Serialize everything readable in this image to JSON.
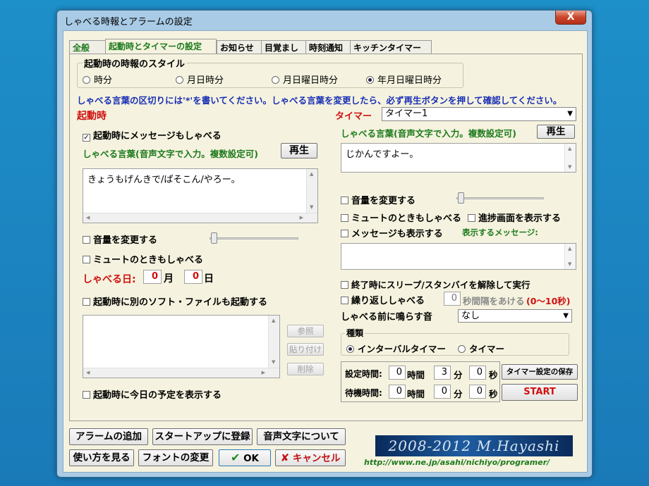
{
  "window": {
    "title": "しゃべる時報とアラームの設定",
    "close_label": "X"
  },
  "tabs": [
    {
      "label": "全般"
    },
    {
      "label": "起動時とタイマーの設定"
    },
    {
      "label": "お知らせ"
    },
    {
      "label": "目覚まし"
    },
    {
      "label": "時刻通知"
    },
    {
      "label": "キッチンタイマー"
    }
  ],
  "style_group": {
    "title": "起動時の時報のスタイル",
    "options": [
      "時分",
      "月日時分",
      "月日曜日時分",
      "年月日曜日時分"
    ],
    "selected": "年月日曜日時分"
  },
  "note": "しゃべる言葉の区切りには'*'を書いてください。しゃべる言葉を変更したら、必ず再生ボタンを押して確認してください。",
  "startup": {
    "heading": "起動時",
    "speak_message_check": "起動時にメッセージもしゃべる",
    "speak_words_label": "しゃべる言葉(音声文字で入力。複数設定可)",
    "play_label": "再生",
    "message_text": "きょうもげんきで/ぱそこん/やろー。",
    "change_volume": "音量を変更する",
    "speak_when_muted": "ミュートのときもしゃべる",
    "speak_day_label": "しゃべる日:",
    "month_value": "0",
    "month_unit": "月",
    "day_value": "0",
    "day_unit": "日",
    "launch_other": "起動時に別のソフト・ファイルも起動する",
    "browse_label": "参照",
    "paste_label": "貼り付け",
    "delete_label": "削除",
    "show_schedule": "起動時に今日の予定を表示する"
  },
  "timer": {
    "heading": "タイマー",
    "selected_timer": "タイマー1",
    "speak_words_label": "しゃべる言葉(音声文字で入力。複数設定可)",
    "play_label": "再生",
    "message_text": "じかんですよー。",
    "change_volume": "音量を変更する",
    "speak_when_muted": "ミュートのときもしゃべる",
    "show_progress": "進捗画面を表示する",
    "show_message": "メッセージも表示する",
    "display_message_label": "表示するメッセージ:",
    "release_sleep": "終了時にスリープ/スタンバイを解除して実行",
    "repeat_label": "繰り返ししゃべる",
    "repeat_value": "0",
    "interval_label": "秒間隔をあける",
    "interval_range": "(0〜10秒)",
    "sound_before_label": "しゃべる前に鳴らす音",
    "sound_before_value": "なし",
    "type_group_title": "種類",
    "type_options": [
      "インターバルタイマー",
      "タイマー"
    ],
    "type_selected": "インターバルタイマー",
    "set_time_label": "設定時間:",
    "wait_time_label": "待機時間:",
    "set_hours": "0",
    "set_minutes": "3",
    "set_seconds": "0",
    "wait_hours": "0",
    "wait_minutes": "0",
    "wait_seconds": "0",
    "unit_hours": "時間",
    "unit_minutes": "分",
    "unit_seconds": "秒",
    "save_label": "タイマー設定の保存",
    "start_label": "START"
  },
  "bottom": {
    "add_alarm": "アラームの追加",
    "register_startup": "スタートアップに登録",
    "about_voice": "音声文字について",
    "how_to_use": "使い方を見る",
    "change_font": "フォントの変更",
    "ok_label": "OK",
    "cancel_label": "キャンセル",
    "banner": "2008-2012 M.Hayashi",
    "url": "http://www.ne.jp/asahi/nichiyo/programer/"
  },
  "colors": {
    "accent_green": "#1d7a1d",
    "accent_red": "#d01010",
    "note_blue": "#1a2fb5"
  }
}
